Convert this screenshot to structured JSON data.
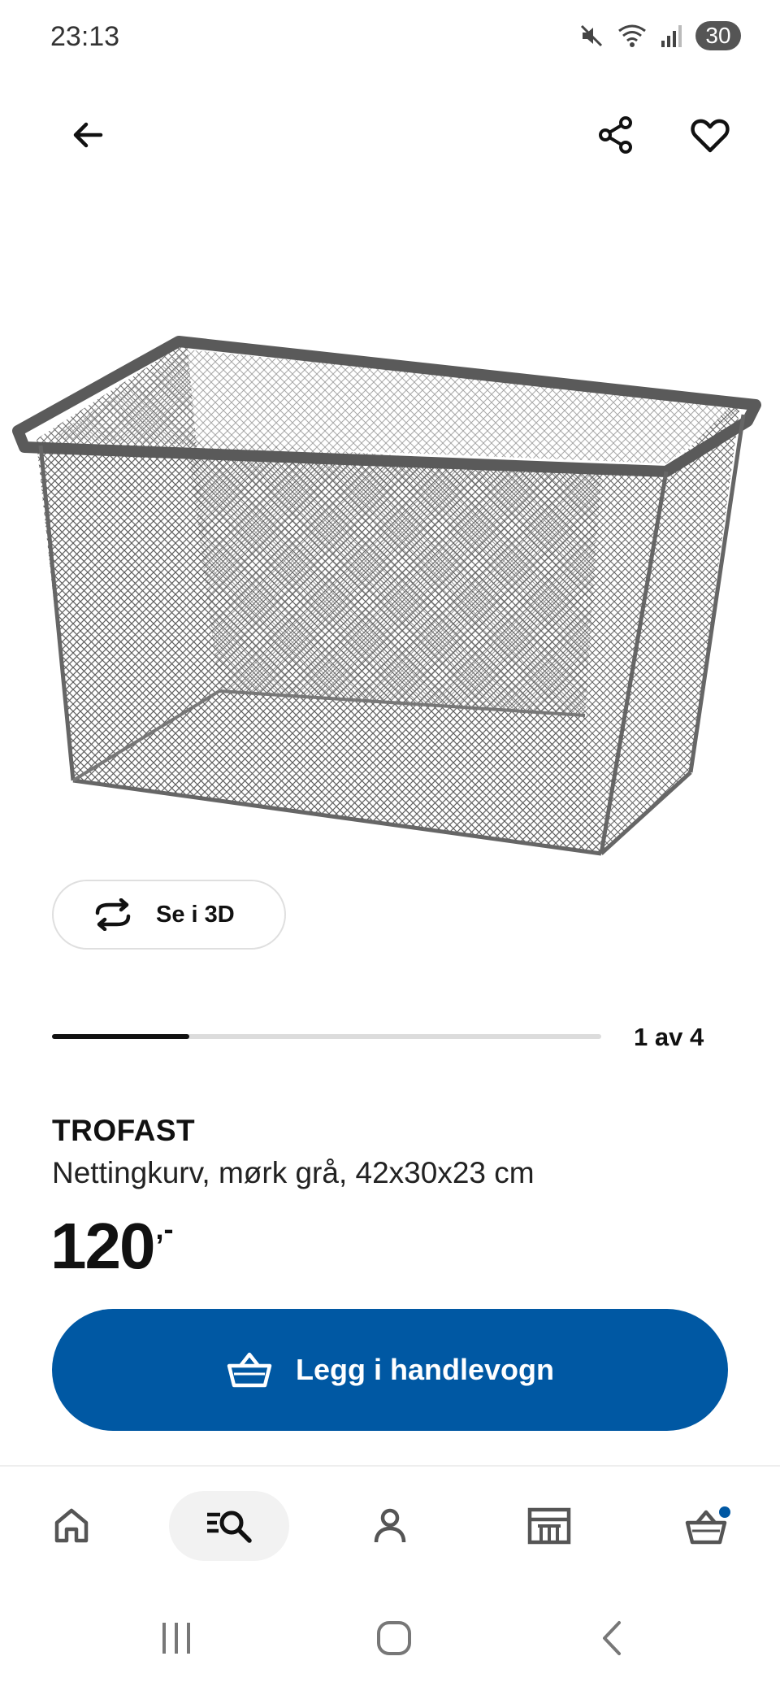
{
  "status_bar": {
    "time": "23:13",
    "battery": "30",
    "icons": [
      "mute-icon",
      "wifi-icon",
      "signal-icon",
      "battery-icon"
    ]
  },
  "top_bar": {
    "icons": [
      "arrow-left-icon",
      "share-icon",
      "heart-icon"
    ]
  },
  "gallery": {
    "view_3d_label": "Se i 3D",
    "counter": "1 av 4",
    "progress_fraction": 0.25
  },
  "product": {
    "name": "TROFAST",
    "description": "Nettingkurv, mørk grå, 42x30x23 cm",
    "price_integer": "120",
    "price_suffix": ",-"
  },
  "add_to_cart": {
    "label": "Legg i handlevogn",
    "icon": "basket-icon"
  },
  "bottom_nav": {
    "active": "search",
    "items": [
      "home-icon",
      "search-list-icon",
      "profile-icon",
      "store-icon",
      "cart-icon"
    ],
    "cart_badge_color": "#0058a3"
  },
  "colors": {
    "brand_blue": "#0058a3",
    "text": "#111111",
    "divider": "#dcdcdc"
  }
}
